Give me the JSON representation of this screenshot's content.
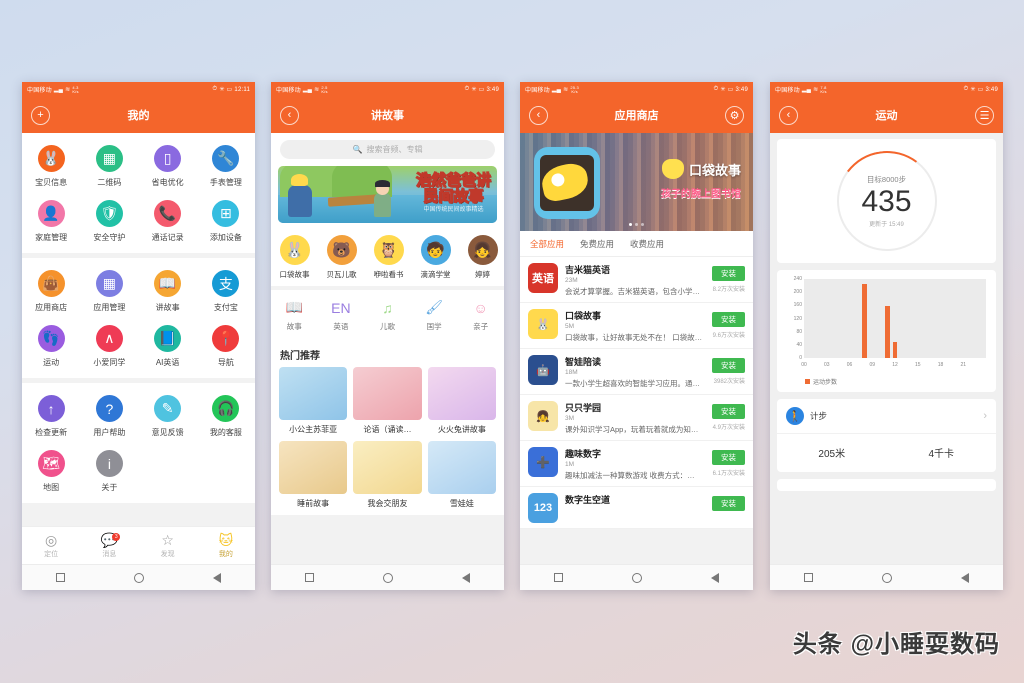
{
  "watermark": "头条 @小睡耍数码",
  "colors": {
    "brand_orange": "#f4652b",
    "install_green": "#3fb950",
    "chart_bar": "#ef6c34",
    "badge_red": "#ef3b2d"
  },
  "phone1": {
    "status": {
      "carrier": "中国移动",
      "net_speed": "4.3",
      "net_unit": "K/s",
      "time": "12:11"
    },
    "title": "我的",
    "add_button": "+",
    "groups": [
      {
        "items": [
          {
            "label": "宝贝信息",
            "icon": "baby-icon",
            "glyph": "🐰",
            "color": "#f4641f"
          },
          {
            "label": "二维码",
            "icon": "qrcode-icon",
            "glyph": "▦",
            "color": "#2bbf86"
          },
          {
            "label": "省电优化",
            "icon": "battery-icon",
            "glyph": "▯",
            "color": "#8a6ae0"
          },
          {
            "label": "手表管理",
            "icon": "wrench-icon",
            "glyph": "🔧",
            "color": "#2f86d6"
          },
          {
            "label": "家庭管理",
            "icon": "family-icon",
            "glyph": "👤",
            "color": "#f277a8"
          },
          {
            "label": "安全守护",
            "icon": "shield-icon",
            "glyph": "🛡",
            "color": "#21c1a6"
          },
          {
            "label": "通话记录",
            "icon": "phonelog-icon",
            "glyph": "📞",
            "color": "#f45a6d"
          },
          {
            "label": "添加设备",
            "icon": "adddevice-icon",
            "glyph": "⊞",
            "color": "#35bde0"
          }
        ]
      },
      {
        "items": [
          {
            "label": "应用商店",
            "icon": "appstore-icon",
            "glyph": "👜",
            "color": "#f5922c"
          },
          {
            "label": "应用管理",
            "icon": "appmanage-icon",
            "glyph": "▦",
            "color": "#7d7ee2"
          },
          {
            "label": "讲故事",
            "icon": "book-icon",
            "glyph": "📖",
            "color": "#f5a633"
          },
          {
            "label": "支付宝",
            "icon": "alipay-icon",
            "glyph": "支",
            "color": "#169bd5"
          },
          {
            "label": "运动",
            "icon": "sport-icon",
            "glyph": "👣",
            "color": "#9a5ce0"
          },
          {
            "label": "小爱同学",
            "icon": "xiaoai-icon",
            "glyph": "∧",
            "color": "#ef3b55"
          },
          {
            "label": "AI英语",
            "icon": "ai-english-icon",
            "glyph": "📘",
            "color": "#1fb8a0"
          },
          {
            "label": "导航",
            "icon": "nav-icon",
            "glyph": "📍",
            "color": "#ef3b3b"
          }
        ]
      },
      {
        "items": [
          {
            "label": "检查更新",
            "icon": "update-icon",
            "glyph": "↑",
            "color": "#7c5fd8"
          },
          {
            "label": "用户帮助",
            "icon": "help-icon",
            "glyph": "?",
            "color": "#2f77d6"
          },
          {
            "label": "意见反馈",
            "icon": "feedback-icon",
            "glyph": "✎",
            "color": "#4fc3e0"
          },
          {
            "label": "我的客服",
            "icon": "support-icon",
            "glyph": "🎧",
            "color": "#23c558"
          },
          {
            "label": "地图",
            "icon": "map-icon",
            "glyph": "🗺",
            "color": "#f0518c"
          },
          {
            "label": "关于",
            "icon": "about-icon",
            "glyph": "i",
            "color": "#8f8f96"
          }
        ]
      }
    ],
    "tabs": [
      {
        "label": "定位",
        "icon": "location-pin-icon",
        "glyph": "◎",
        "active": false,
        "badge": ""
      },
      {
        "label": "消息",
        "icon": "message-icon",
        "glyph": "💬",
        "active": false,
        "badge": "3"
      },
      {
        "label": "发现",
        "icon": "star-icon",
        "glyph": "☆",
        "active": false,
        "badge": ""
      },
      {
        "label": "我的",
        "icon": "profile-icon",
        "glyph": "🐱",
        "active": true,
        "badge": ""
      }
    ]
  },
  "phone2": {
    "status": {
      "carrier": "中国移动",
      "net_speed": "2.5",
      "net_unit": "K/s",
      "time": "3:49"
    },
    "title": "讲故事",
    "back": "‹",
    "search_placeholder": "搜索音频、专辑",
    "banner": {
      "line1": "浩然爸爸讲",
      "line2": "民间故事",
      "line3": "中国传统民间故事精选"
    },
    "publishers": [
      {
        "label": "口袋故事",
        "icon": "pocket-story-icon",
        "glyph": "🐰",
        "color": "#ffd94d"
      },
      {
        "label": "贝瓦儿歌",
        "icon": "beva-icon",
        "glyph": "🐻",
        "color": "#f2a03c"
      },
      {
        "label": "咿啦看书",
        "icon": "yila-icon",
        "glyph": "🦉",
        "color": "#ffd94d"
      },
      {
        "label": "滴滴学堂",
        "icon": "didi-school-icon",
        "glyph": "🧒",
        "color": "#4aa9e0"
      },
      {
        "label": "婷婷",
        "icon": "tingting-icon",
        "glyph": "👧",
        "color": "#8a5a3c"
      }
    ],
    "categories": [
      {
        "label": "故事",
        "icon": "book-open-icon",
        "glyph": "📖",
        "color": "#7fd4e8"
      },
      {
        "label": "英语",
        "icon": "english-icon",
        "glyph": "EN",
        "color": "#9a7ee0"
      },
      {
        "label": "儿歌",
        "icon": "music-note-icon",
        "glyph": "♫",
        "color": "#9fd98a"
      },
      {
        "label": "国学",
        "icon": "brush-icon",
        "glyph": "🖌",
        "color": "#5fa8e0"
      },
      {
        "label": "亲子",
        "icon": "parentchild-icon",
        "glyph": "☺",
        "color": "#f29ab8"
      }
    ],
    "section_title": "热门推荐",
    "cards": [
      {
        "label": "小公主苏菲亚",
        "color1": "#bfe0f2",
        "color2": "#8fc4e8"
      },
      {
        "label": "论语（诵读…",
        "color1": "#f5cdd2",
        "color2": "#eda3ac"
      },
      {
        "label": "火火兔讲故事",
        "color1": "#f3d9ef",
        "color2": "#d9b6ea"
      },
      {
        "label": "睡前故事",
        "color1": "#f6e4c0",
        "color2": "#e8c98b"
      },
      {
        "label": "我会交朋友",
        "color1": "#faeec2",
        "color2": "#f2d78f"
      },
      {
        "label": "雪娃娃",
        "color1": "#d5e9f7",
        "color2": "#a9cfee"
      }
    ]
  },
  "phone3": {
    "status": {
      "carrier": "中国移动",
      "net_speed": "25.3",
      "net_unit": "K/s",
      "time": "3:49"
    },
    "title": "应用商店",
    "back": "‹",
    "settings_icon": "gear-icon",
    "hero": {
      "logo_text": "口袋故事",
      "subtitle": "孩子的腕上图书馆"
    },
    "tabs": [
      {
        "label": "全部应用",
        "active": true
      },
      {
        "label": "免费应用",
        "active": false
      },
      {
        "label": "收费应用",
        "active": false
      }
    ],
    "install_label": "安装",
    "apps": [
      {
        "name": "吉米猫英语",
        "size": "23M",
        "count": "8.2万次安装",
        "desc": "会说才算掌握。吉米猫英语，包含小学…",
        "icon_text": "英语",
        "icon_color": "#d8352a"
      },
      {
        "name": "口袋故事",
        "size": "5M",
        "count": "9.6万次安装",
        "desc": "口袋故事，让好故事无处不在！ 口袋故…",
        "icon_text": "🐰",
        "icon_color": "#ffd94d"
      },
      {
        "name": "智娃陪读",
        "size": "18M",
        "count": "3982次安装",
        "desc": "一款小学生超喜欢的智能学习应用。通…",
        "icon_text": "🤖",
        "icon_color": "#2b4f8f"
      },
      {
        "name": "只只学园",
        "size": "3M",
        "count": "4.9万次安装",
        "desc": "课外知识学习App，玩着玩着就成为知…",
        "icon_text": "👧",
        "icon_color": "#f7e5a8"
      },
      {
        "name": "趣味数字",
        "size": "1M",
        "count": "6.1万次安装",
        "desc": "趣味加减法一种算数游戏 收费方式：…",
        "icon_text": "➕",
        "icon_color": "#3a6fd8"
      },
      {
        "name": "数字生空道",
        "size": "",
        "count": "",
        "desc": "",
        "icon_text": "123",
        "icon_color": "#4aa0e0"
      }
    ]
  },
  "phone4": {
    "status": {
      "carrier": "中国移动",
      "net_speed": "7.8",
      "net_unit": "K/s",
      "time": "3:49"
    },
    "title": "运动",
    "back": "‹",
    "menu_icon": "hamburger-icon",
    "ring": {
      "goal": "目标8000步",
      "value": "435",
      "updated": "更新于 15:49"
    },
    "step_card": {
      "icon": "walking-icon",
      "label": "计步",
      "chevron": "›",
      "distance": "205米",
      "calories": "4千卡"
    }
  },
  "chart_data": {
    "type": "bar",
    "title": "",
    "xlabel": "",
    "ylabel": "",
    "legend": [
      "运动步数"
    ],
    "legend_position": "bottom-left",
    "grid": false,
    "categories": [
      "00",
      "03",
      "06",
      "09",
      "12",
      "15",
      "18",
      "21"
    ],
    "x_ticks": [
      0,
      3,
      6,
      9,
      12,
      15,
      18,
      21
    ],
    "xlim": [
      0,
      24
    ],
    "ylim": [
      0,
      240
    ],
    "y_ticks": [
      0,
      40,
      80,
      120,
      160,
      200,
      240
    ],
    "series": [
      {
        "name": "运动步数",
        "color": "#ef6c34",
        "points": [
          {
            "hour": 8,
            "value": 225
          },
          {
            "hour": 11,
            "value": 157
          },
          {
            "hour": 12,
            "value": 50
          }
        ]
      }
    ]
  }
}
